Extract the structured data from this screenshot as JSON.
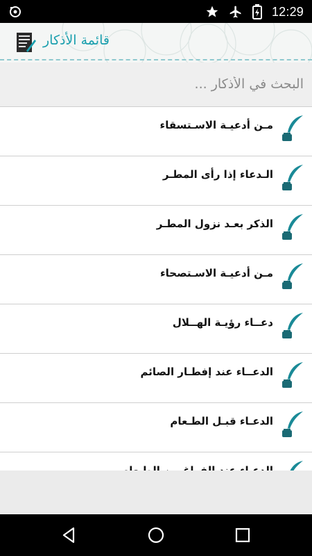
{
  "status_bar": {
    "time": "12:29",
    "left_icon": "sync-icon",
    "right_icons": [
      "star-icon",
      "airplane-icon",
      "battery-icon"
    ]
  },
  "app_bar": {
    "title": "قائمة الأذكار",
    "icon": "document-list-icon",
    "accent_color": "#1a9fae"
  },
  "search": {
    "placeholder": "البحث في الأذكار ...",
    "value": ""
  },
  "list": {
    "item_icon": "quill-ink-icon",
    "items": [
      {
        "label": "مـن أدعيـة الاسـتسقاء"
      },
      {
        "label": "الـدعاء إذا رأى المطـر"
      },
      {
        "label": "الذكر بعـد نزول المطـر"
      },
      {
        "label": "مـن أدعيـة الاسـتصحاء"
      },
      {
        "label": "دعــاء رؤيـة الهــلال"
      },
      {
        "label": "الدعــاء عند إفطـار الصائم"
      },
      {
        "label": "الدعـاء قبـل الطـعام"
      },
      {
        "label": "الدعـاء عند الفراغ من الطـعام"
      }
    ]
  },
  "nav_bar": {
    "buttons": [
      "back-icon",
      "home-icon",
      "recents-icon"
    ]
  }
}
